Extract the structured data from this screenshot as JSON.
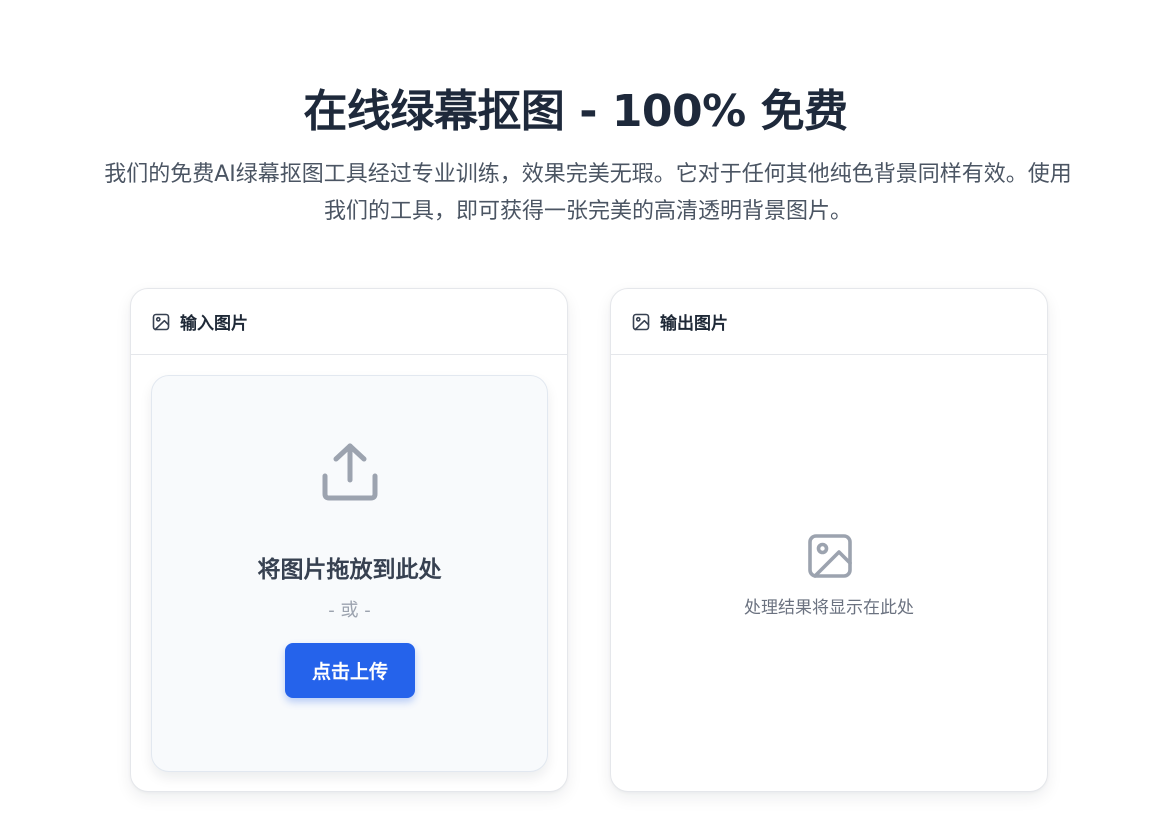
{
  "hero": {
    "title": "在线绿幕抠图 - 100% 免费",
    "description": "我们的免费AI绿幕抠图工具经过专业训练，效果完美无瑕。它对于任何其他纯色背景同样有效。使用我们的工具，即可获得一张完美的高清透明背景图片。"
  },
  "input_card": {
    "icon": "image-icon",
    "title": "输入图片",
    "dropzone": {
      "icon": "upload-icon",
      "title": "将图片拖放到此处",
      "or_text": "- 或 -",
      "button_label": "点击上传"
    }
  },
  "output_card": {
    "icon": "image-icon",
    "title": "输出图片",
    "placeholder_icon": "image-placeholder-icon",
    "placeholder_text": "处理结果将显示在此处"
  },
  "colors": {
    "accent": "#2563eb",
    "title_text": "#1e293b",
    "muted_text": "#6b7280",
    "icon_gray": "#9ca3af"
  }
}
